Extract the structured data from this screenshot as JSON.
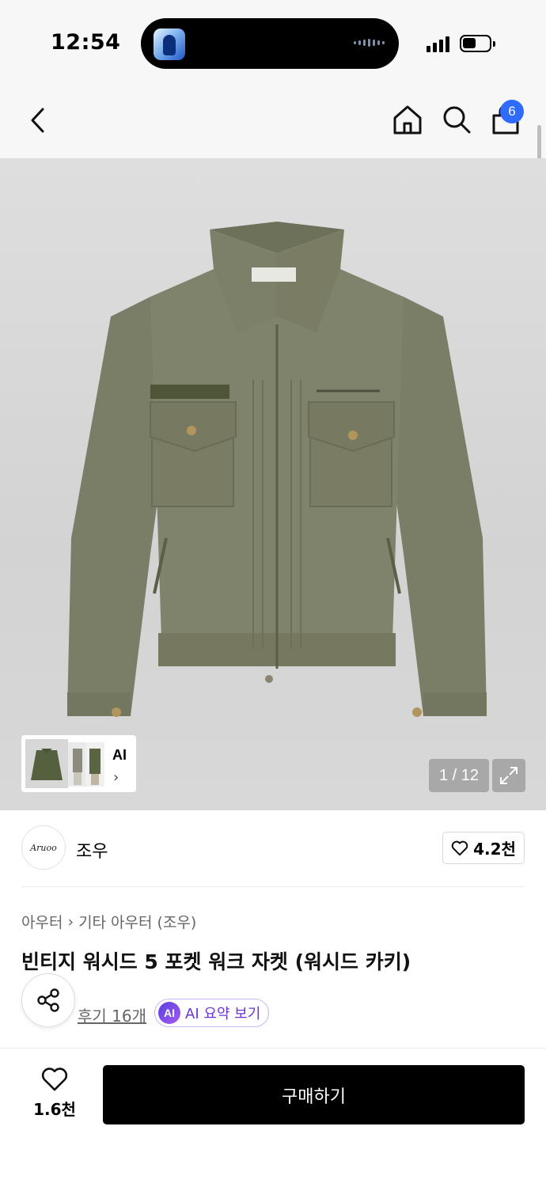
{
  "status_bar": {
    "time": "12:54"
  },
  "nav": {
    "cart_count": "6"
  },
  "gallery": {
    "counter": "1 / 12",
    "ai_label": "AI",
    "ai_chevron": "›"
  },
  "brand": {
    "logo_text": "Aruoo",
    "name": "조우",
    "like_count": "4.2천"
  },
  "breadcrumb": {
    "level1": "아우터",
    "separator": "›",
    "level2": "기타 아우터 (조우)"
  },
  "product": {
    "title": "빈티지 워시드 5 포켓 워크 자켓 (워시드 카키)"
  },
  "reviews": {
    "link": "후기 16개"
  },
  "ai_summary": {
    "badge": "AI",
    "label": "AI 요약 보기"
  },
  "bottom": {
    "wish_count": "1.6천",
    "buy_label": "구매하기"
  },
  "colors": {
    "accent": "#2f6bff",
    "ai_purple": "#6b35d6",
    "buy_bg": "#000000",
    "jacket": "#7d8068"
  }
}
